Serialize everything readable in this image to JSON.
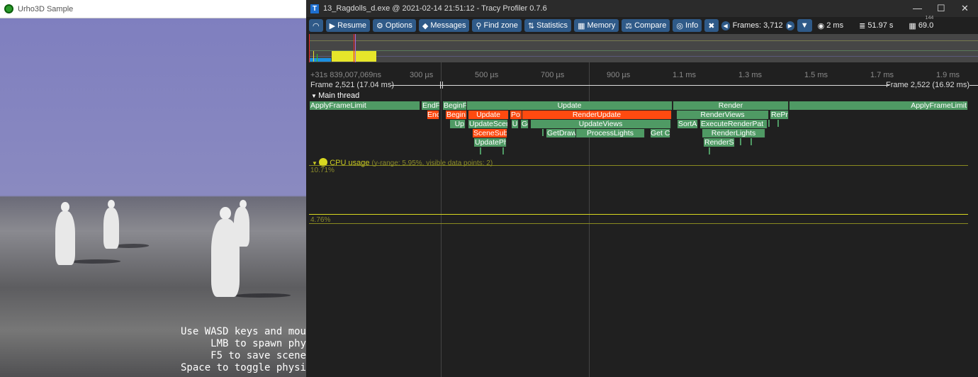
{
  "left_window": {
    "title": "Urho3D Sample",
    "overlay_lines": [
      "Use WASD keys and mou",
      "LMB to spawn phy",
      "F5 to save scene",
      "Space to toggle physi"
    ]
  },
  "tracy": {
    "title": "13_Ragdolls_d.exe @ 2021-02-14 21:51:12 - Tracy Profiler 0.7.6",
    "toolbar": {
      "connection_icon": "wifi-icon",
      "resume": "Resume",
      "options": "Options",
      "messages": "Messages",
      "find_zone": "Find zone",
      "statistics": "Statistics",
      "memory": "Memory",
      "compare": "Compare",
      "info": "Info",
      "frames": "Frames: 3,712",
      "view_time": "2 ms",
      "total_time": "51.97 s",
      "memory_value": "69.0",
      "memory_small": "144"
    },
    "ruler": {
      "start": "+31s 839,007,069ns",
      "ticks": [
        "300 µs",
        "500 µs",
        "700 µs",
        "900 µs",
        "1.1 ms",
        "1.3 ms",
        "1.5 ms",
        "1.7 ms",
        "1.9 ms"
      ]
    },
    "frames": {
      "left": "Frame 2,521 (17.04 ms)",
      "right": "Frame 2,522 (16.92 ms)"
    },
    "thread": "Main thread",
    "zones": [
      "ApplyFrameLimit",
      "EndF",
      "BeginF",
      "Update",
      "Render",
      "ApplyFrameLimit",
      "Enc",
      "BeginI",
      "Update",
      "Po",
      "RenderUpdate",
      "RenderViews",
      "RePre",
      "Up",
      "UpdateScen",
      "U",
      "Ge",
      "UpdateViews",
      "SortA",
      "ExecuteRenderPat",
      "SceneSub",
      "GetDraw",
      "ProcessLights",
      "Get C",
      "RenderLights",
      "UpdatePh",
      "RenderSh"
    ],
    "cpu": {
      "label": "CPU usage",
      "info": "(y-range: 5.95%, visible data points: 2)",
      "max": "10.71%",
      "min": "4.76%"
    },
    "colors": {
      "zone": "#4f9a64",
      "zone_hot": "#ff4a10",
      "button": "#2f5a88",
      "plot": "#c8c820"
    }
  }
}
